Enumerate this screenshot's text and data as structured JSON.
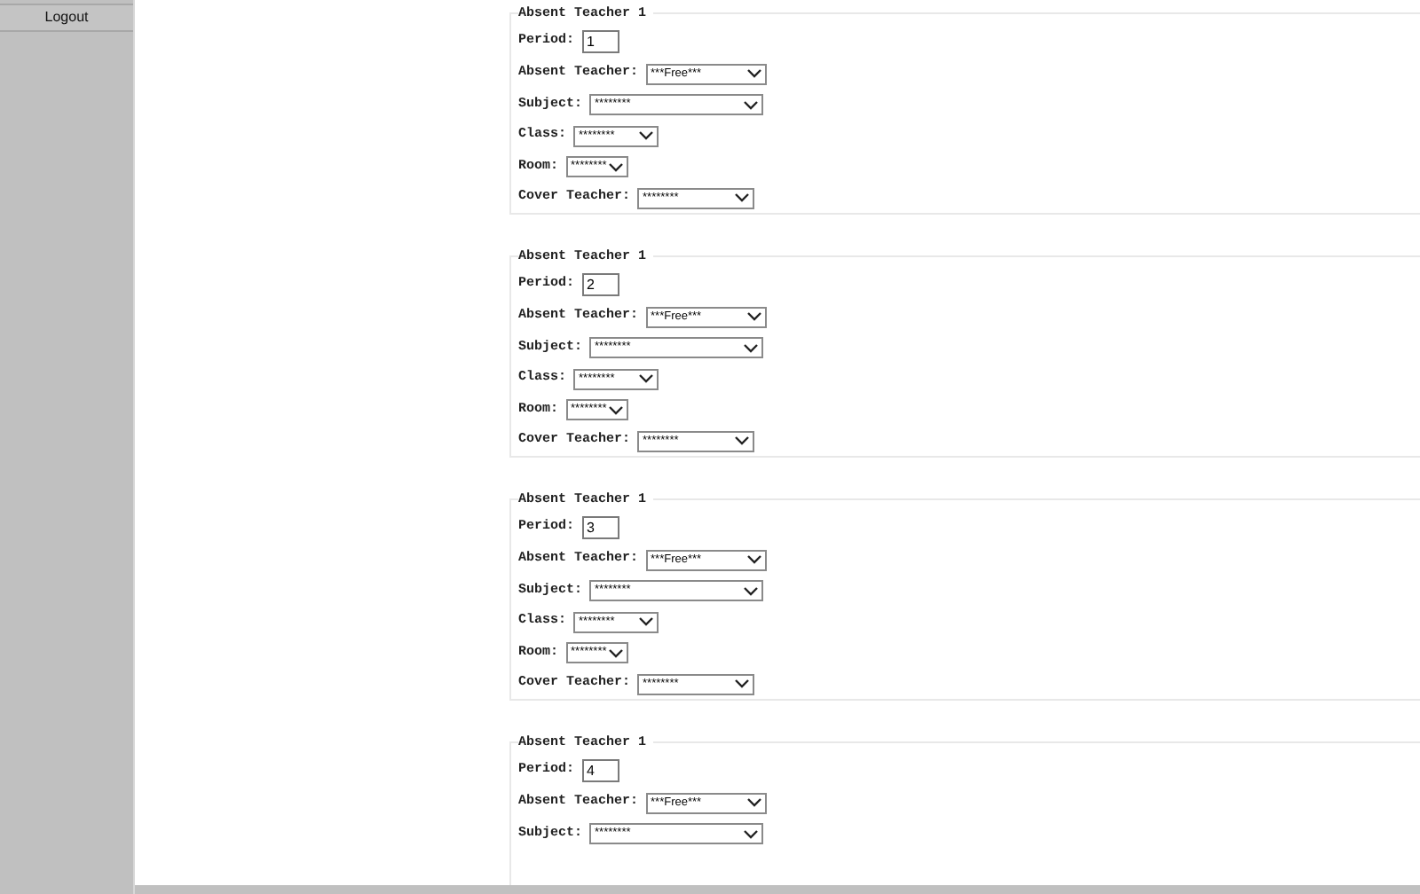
{
  "sidebar": {
    "items": [
      {
        "label": "Logout"
      }
    ]
  },
  "forms": [
    {
      "legend": "Absent Teacher 1",
      "fields": [
        {
          "kind": "input",
          "label": "Period:",
          "value": "1"
        },
        {
          "kind": "select",
          "label": "Absent Teacher:",
          "value": "***Free***"
        },
        {
          "kind": "select",
          "label": "Subject:",
          "value": "********"
        },
        {
          "kind": "select",
          "label": "Class:",
          "value": "********"
        },
        {
          "kind": "select",
          "label": "Room:",
          "value": "********"
        },
        {
          "kind": "select",
          "label": "Cover Teacher:",
          "value": "********"
        }
      ]
    },
    {
      "legend": "Absent Teacher 1",
      "fields": [
        {
          "kind": "input",
          "label": "Period:",
          "value": "2"
        },
        {
          "kind": "select",
          "label": "Absent Teacher:",
          "value": "***Free***"
        },
        {
          "kind": "select",
          "label": "Subject:",
          "value": "********"
        },
        {
          "kind": "select",
          "label": "Class:",
          "value": "********"
        },
        {
          "kind": "select",
          "label": "Room:",
          "value": "********"
        },
        {
          "kind": "select",
          "label": "Cover Teacher:",
          "value": "********"
        }
      ]
    },
    {
      "legend": "Absent Teacher 1",
      "fields": [
        {
          "kind": "input",
          "label": "Period:",
          "value": "3"
        },
        {
          "kind": "select",
          "label": "Absent Teacher:",
          "value": "***Free***"
        },
        {
          "kind": "select",
          "label": "Subject:",
          "value": "********"
        },
        {
          "kind": "select",
          "label": "Class:",
          "value": "********"
        },
        {
          "kind": "select",
          "label": "Room:",
          "value": "********"
        },
        {
          "kind": "select",
          "label": "Cover Teacher:",
          "value": "********"
        }
      ]
    },
    {
      "legend": "Absent Teacher 1",
      "fields": [
        {
          "kind": "input",
          "label": "Period:",
          "value": "4"
        },
        {
          "kind": "select",
          "label": "Absent Teacher:",
          "value": "***Free***"
        },
        {
          "kind": "select",
          "label": "Subject:",
          "value": "********"
        }
      ]
    }
  ]
}
